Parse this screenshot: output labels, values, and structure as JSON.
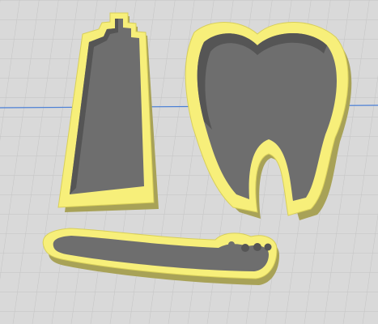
{
  "viewport": {
    "background_color": "#d9d9d9",
    "grid_color": "#c4c4c4",
    "axis_color": "#4a7fd6"
  },
  "models": [
    {
      "name": "toothpaste-tube",
      "wall_color": "#f7ef7a",
      "wall_shadow_color": "#a8a257",
      "interior_color": "#6e6e6e"
    },
    {
      "name": "molar-tooth",
      "wall_color": "#f7ef7a",
      "wall_shadow_color": "#a8a257",
      "interior_color": "#6e6e6e"
    },
    {
      "name": "toothbrush",
      "wall_color": "#f7ef7a",
      "wall_shadow_color": "#a8a257",
      "interior_color": "#6e6e6e"
    }
  ]
}
